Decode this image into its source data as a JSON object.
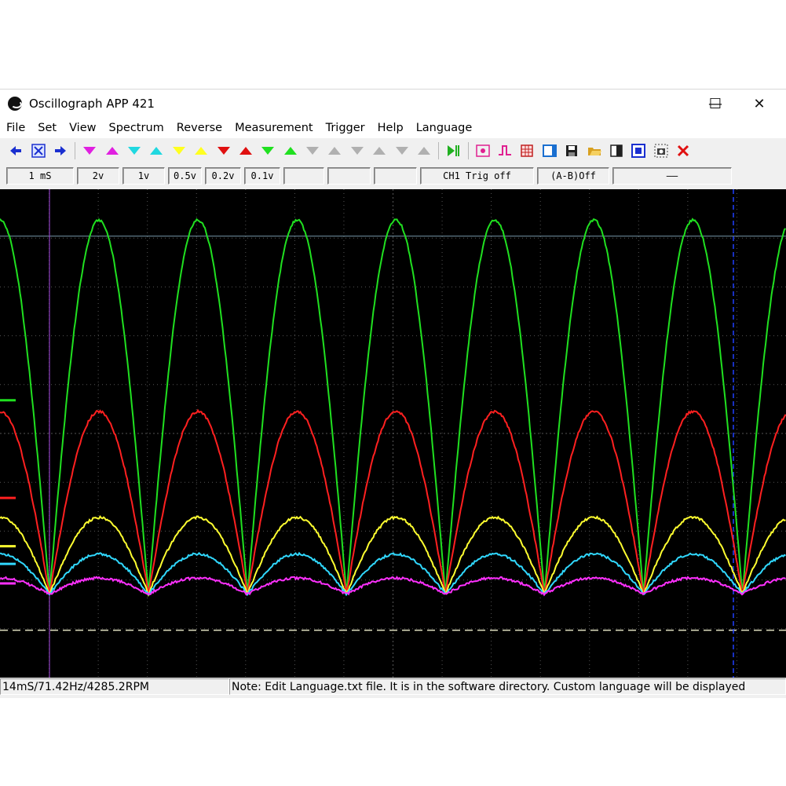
{
  "window": {
    "title": "Oscillograph APP 421",
    "controls": {
      "minimize": "—",
      "maximize": "☐",
      "close": "✕"
    }
  },
  "menu": [
    "File",
    "Set",
    "View",
    "Spectrum",
    "Reverse",
    "Measurement",
    "Trigger",
    "Help",
    "Language"
  ],
  "toolbar": [
    {
      "icon": "arrow-left-icon",
      "color": "#1a2fd0"
    },
    {
      "icon": "cross-cursor-icon",
      "color": "#1a2fd0"
    },
    {
      "icon": "arrow-right-icon",
      "color": "#1a2fd0"
    },
    {
      "sep": true
    },
    {
      "icon": "triangle-down-icon",
      "color": "#e020e0"
    },
    {
      "icon": "triangle-up-icon",
      "color": "#e020e0"
    },
    {
      "icon": "triangle-down-icon",
      "color": "#20d8e0"
    },
    {
      "icon": "triangle-up-icon",
      "color": "#20d8e0"
    },
    {
      "icon": "triangle-down-icon",
      "color": "#ffff20"
    },
    {
      "icon": "triangle-up-icon",
      "color": "#ffff20"
    },
    {
      "icon": "triangle-down-icon",
      "color": "#e01010"
    },
    {
      "icon": "triangle-up-icon",
      "color": "#e01010"
    },
    {
      "icon": "triangle-down-icon",
      "color": "#20e020"
    },
    {
      "icon": "triangle-up-icon",
      "color": "#20e020"
    },
    {
      "icon": "triangle-down-icon",
      "color": "#b0b0b0"
    },
    {
      "icon": "triangle-up-icon",
      "color": "#b0b0b0"
    },
    {
      "icon": "triangle-down-icon",
      "color": "#b0b0b0"
    },
    {
      "icon": "triangle-up-icon",
      "color": "#b0b0b0"
    },
    {
      "icon": "triangle-down-icon",
      "color": "#b0b0b0"
    },
    {
      "icon": "triangle-up-icon",
      "color": "#b0b0b0"
    },
    {
      "sep": true
    },
    {
      "icon": "play-pause-icon",
      "color": "#20b020"
    },
    {
      "sep": true
    },
    {
      "icon": "trigger-mode-icon",
      "color": "#e02090"
    },
    {
      "icon": "pulse-edge-icon",
      "color": "#e02090"
    },
    {
      "icon": "grid-table-icon",
      "color": "#c02020"
    },
    {
      "icon": "window-panel-icon",
      "color": "#1a6fd0"
    },
    {
      "icon": "save-disk-icon",
      "color": "#202020"
    },
    {
      "icon": "open-folder-icon",
      "color": "#d8a020"
    },
    {
      "icon": "contrast-icon",
      "color": "#202020"
    },
    {
      "icon": "target-square-icon",
      "color": "#1a2fd0"
    },
    {
      "icon": "camera-capture-icon",
      "color": "#404040"
    },
    {
      "icon": "close-x-icon",
      "color": "#e01010"
    }
  ],
  "fields": [
    {
      "text": "1 mS",
      "w": 86
    },
    {
      "text": "2v",
      "w": 54
    },
    {
      "text": "1v",
      "w": 54
    },
    {
      "text": "0.5v",
      "w": 43
    },
    {
      "text": "0.2v",
      "w": 46
    },
    {
      "text": "0.1v",
      "w": 46
    },
    {
      "text": "",
      "w": 52
    },
    {
      "text": "",
      "w": 55
    },
    {
      "text": "",
      "w": 55
    },
    {
      "text": "CH1 Trig off",
      "w": 145
    },
    {
      "text": "(A-B)Off",
      "w": 92
    },
    {
      "text": "——",
      "w": 152
    }
  ],
  "status": {
    "left": "14mS/71.42Hz/4285.2RPM",
    "right": "Note: Edit Language.txt file. It is in the software directory. Custom language will be displayed"
  },
  "scope": {
    "grid_color": "#555555",
    "periods": 7.94,
    "channels": [
      {
        "name": "green",
        "color": "#20e020",
        "peak": 0.063,
        "trough": 0.829
      },
      {
        "name": "red",
        "color": "#ff2020",
        "peak": 0.455,
        "trough": 0.829
      },
      {
        "name": "yellow",
        "color": "#ffff30",
        "peak": 0.672,
        "trough": 0.829
      },
      {
        "name": "cyan",
        "color": "#30d8ff",
        "peak": 0.747,
        "trough": 0.829
      },
      {
        "name": "magenta",
        "color": "#ff30ff",
        "peak": 0.796,
        "trough": 0.829
      }
    ]
  }
}
